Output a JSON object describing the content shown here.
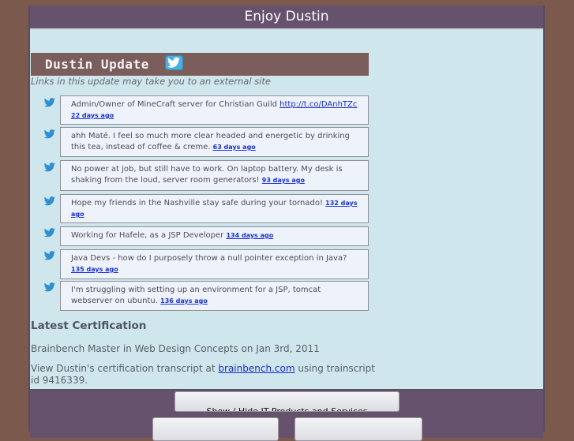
{
  "header": {
    "title": "Enjoy Dustin"
  },
  "update": {
    "title": "Dustin Update",
    "external_note": "Links in this update may take you to an external site"
  },
  "tweets": [
    {
      "text": "Admin/Owner of MineCraft server for Christian Guild",
      "link": "http://t.co/DAnhTZc",
      "age": "22 days ago"
    },
    {
      "text": "ahh Maté. I feel so much more clear headed and energetic by drinking this tea, instead of coffee & creme.",
      "age": "63 days ago"
    },
    {
      "text": "No power at job, but still have to work. On laptop battery. My desk is shaking from the loud, server room generators!",
      "age": "93 days ago"
    },
    {
      "text": "Hope my friends in the Nashville stay safe during your tornado!",
      "age": "132 days ago"
    },
    {
      "text": "Working for Hafele, as a JSP Developer",
      "age": "134 days ago"
    },
    {
      "text": "Java Devs - how do I purposely throw a null pointer exception in Java?",
      "age": "135 days ago"
    },
    {
      "text": "I'm struggling with setting up an environment for a JSP, tomcat webserver on ubuntu.",
      "age": "136 days ago"
    }
  ],
  "certification": {
    "heading": "Latest Certification",
    "line1": "Brainbench Master in Web Design Concepts on Jan 3rd, 2011",
    "line2_prefix": "View Dustin's certification transcript at",
    "line2_link": "brainbench.com",
    "line2_suffix": "using trainscript id 9416339."
  },
  "footer": {
    "toggle_label": "Show / Hide IT Products and Services"
  },
  "colors": {
    "background": "#7b5a4d",
    "content": "#cfe6ed",
    "header_bar": "#66526d",
    "update_bar": "#7b5e5b",
    "twitter_blue": "#4aaee1",
    "link": "#1a2ec9"
  }
}
